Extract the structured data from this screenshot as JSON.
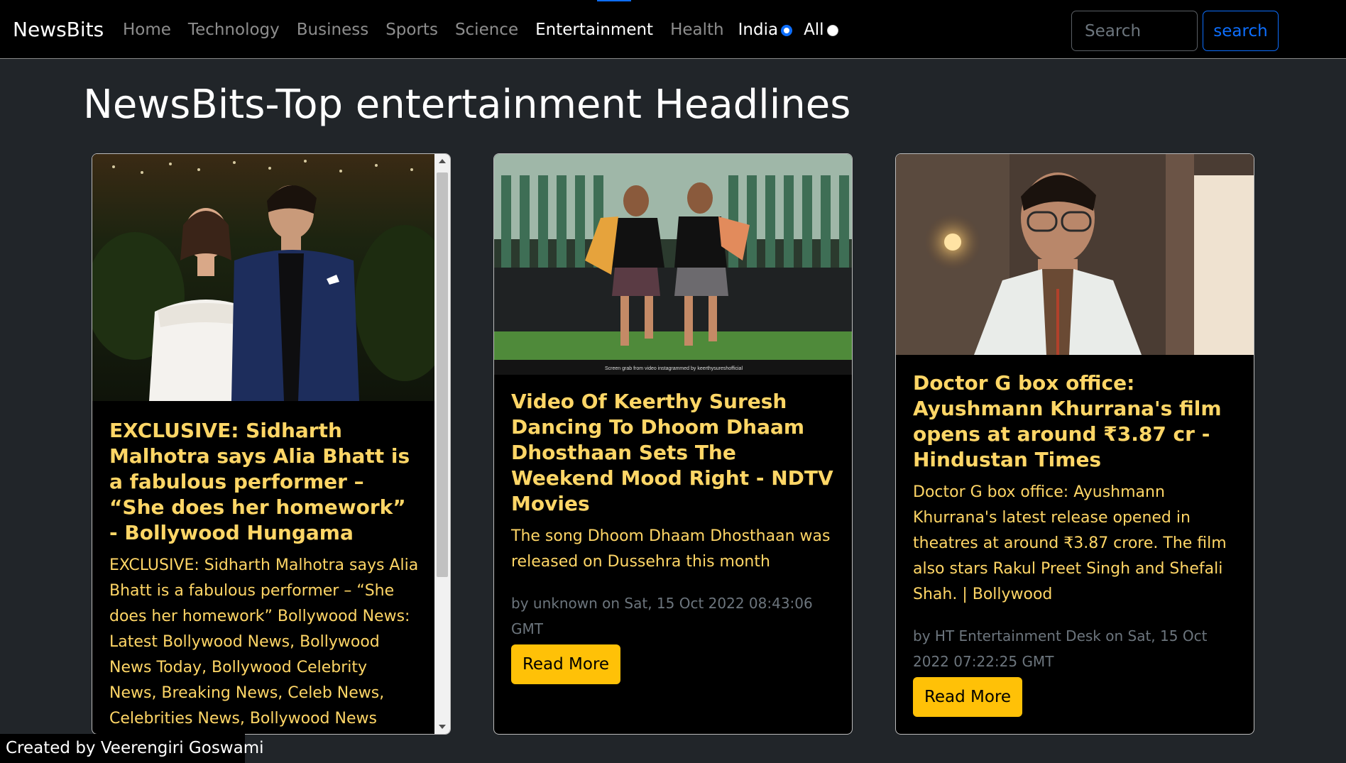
{
  "navbar": {
    "brand": "NewsBits",
    "links": [
      {
        "label": "Home",
        "active": false
      },
      {
        "label": "Technology",
        "active": false
      },
      {
        "label": "Business",
        "active": false
      },
      {
        "label": "Sports",
        "active": false
      },
      {
        "label": "Science",
        "active": false
      },
      {
        "label": "Entertainment",
        "active": true
      },
      {
        "label": "Health",
        "active": false
      }
    ],
    "region": {
      "india_label": "India",
      "all_label": "All",
      "selected": "India"
    },
    "search": {
      "placeholder": "Search",
      "value": "",
      "button_label": "search"
    }
  },
  "page": {
    "title": "NewsBits-Top entertainment Headlines"
  },
  "articles": [
    {
      "title": "EXCLUSIVE: Sidharth Malhotra says Alia Bhatt is a fabulous performer – “She does her homework” - Bollywood Hungama",
      "description": "EXCLUSIVE: Sidharth Malhotra says Alia Bhatt is a fabulous performer – “She does her homework” Bollywood News: Latest Bollywood News, Bollywood News Today, Bollywood Celebrity News, Breaking News, Celeb News, Celebrities News, Bollywood News Hindi, Hindi",
      "author": "",
      "date": "",
      "button_label": "Read More"
    },
    {
      "title": "Video Of Keerthy Suresh Dancing To Dhoom Dhaam Dhosthaan Sets The Weekend Mood Right - NDTV Movies",
      "description": "The song Dhoom Dhaam Dhosthaan was released on Dussehra this month",
      "image_caption": "Screen grab from video instagrammed by keerthysureshofficial",
      "meta": "by unknown on Sat, 15 Oct 2022 08:43:06 GMT",
      "button_label": "Read More"
    },
    {
      "title": "Doctor G box office: Ayushmann Khurrana's film opens at around ₹3.87 cr - Hindustan Times",
      "description": "Doctor G box office: Ayushmann Khurrana's latest release opened in theatres at around ₹3.87 crore. The film also stars Rakul Preet Singh and Shefali Shah. | Bollywood",
      "meta": "by HT Entertainment Desk on Sat, 15 Oct 2022 07:22:25 GMT",
      "button_label": "Read More"
    }
  ],
  "footer": {
    "credit": "Created by Veerengiri Goswami"
  },
  "colors": {
    "page_bg": "#212529",
    "navbar_bg": "#000000",
    "card_bg": "#000000",
    "accent_text": "#ffd666",
    "button_bg": "#ffc107",
    "primary": "#0d6efd",
    "muted": "#6c757d"
  }
}
